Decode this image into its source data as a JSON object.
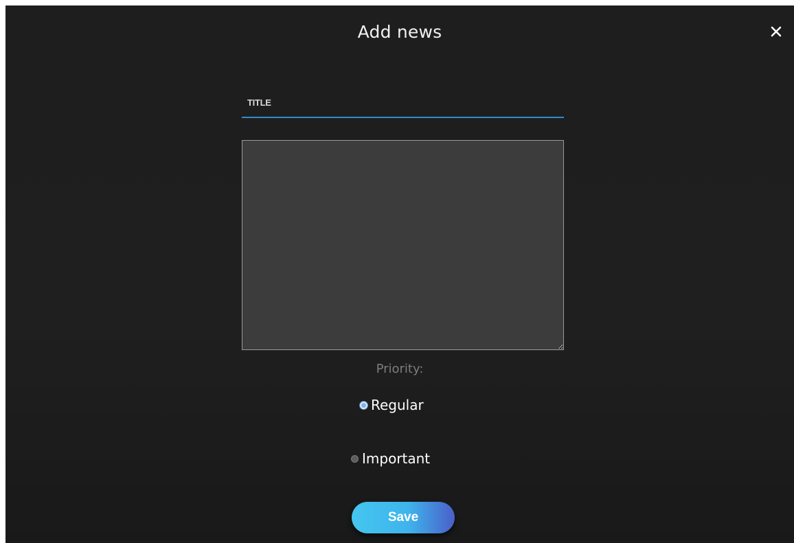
{
  "modal": {
    "title": "Add news",
    "close_icon": "close-icon"
  },
  "form": {
    "title_placeholder": "TITLE",
    "title_value": "",
    "body_value": "",
    "priority_label": "Priority:",
    "priority_options": [
      {
        "label": "Regular",
        "selected": true
      },
      {
        "label": "Important",
        "selected": false
      }
    ],
    "save_label": "Save"
  },
  "colors": {
    "background": "#1e1e1e",
    "accent_underline": "#2d8fc7",
    "textarea_bg": "#3c3c3c",
    "save_gradient_start": "#44c6ef",
    "save_gradient_end": "#4a5fc9"
  }
}
